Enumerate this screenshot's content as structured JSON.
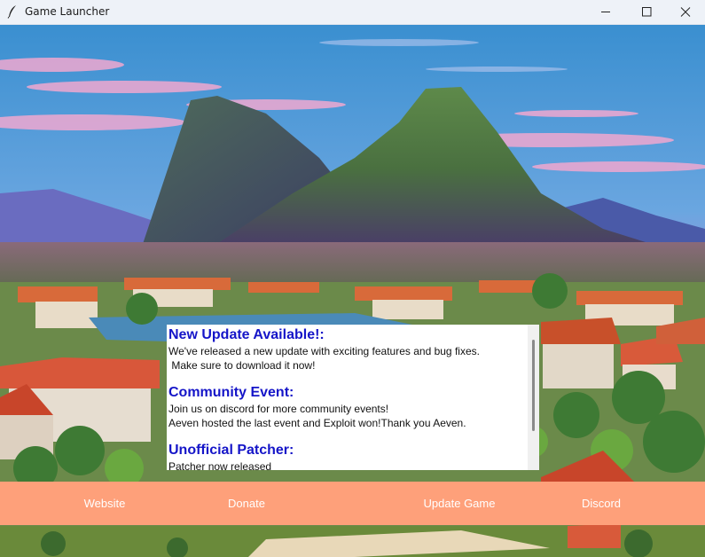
{
  "window": {
    "title": "Game Launcher",
    "icon": "quill-icon",
    "controls": [
      "minimize-icon",
      "maximize-icon",
      "close-icon"
    ]
  },
  "news": {
    "items": [
      {
        "heading": "New Update Available!:",
        "lines": [
          "We've released a new update with exciting features and bug fixes.",
          " Make sure to download it now!"
        ]
      },
      {
        "heading": "Community Event:",
        "lines": [
          "Join us on discord for more community events!",
          "Aeven hosted the last event and Exploit won!Thank you Aeven."
        ]
      },
      {
        "heading": "Unofficial Patcher:",
        "lines": [
          "Patcher now released"
        ]
      }
    ],
    "heading_color": "#1515c8"
  },
  "buttons": {
    "website": "Website",
    "donate": "Donate",
    "update": "Update Game",
    "discord": "Discord",
    "bar_color": "#fea07a"
  }
}
